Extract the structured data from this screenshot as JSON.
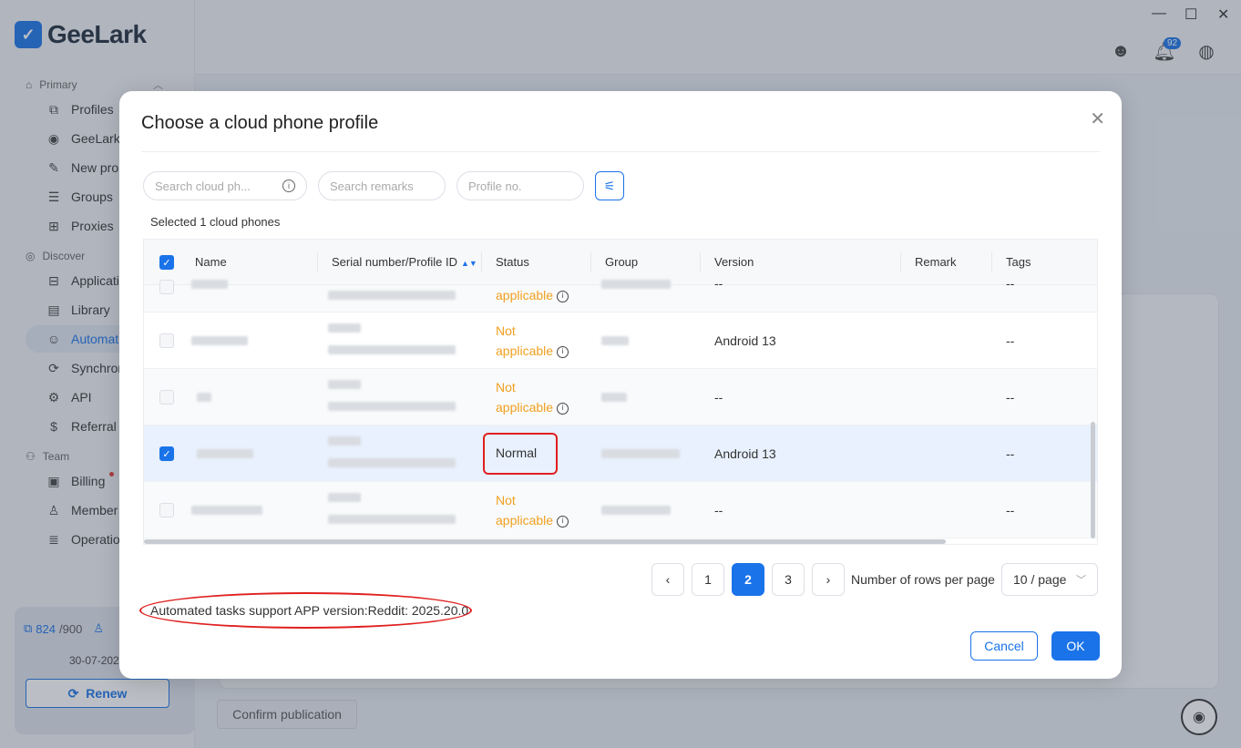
{
  "app": {
    "logo_text": "GeeLark",
    "window_controls": [
      "—",
      "☐",
      "✕"
    ],
    "notification_count": "92"
  },
  "sidebar": {
    "section_primary": "Primary",
    "section_discover": "Discover",
    "section_team": "Team",
    "items": [
      {
        "label": "Profiles",
        "icon": "profiles-icon"
      },
      {
        "label": "GeeLark",
        "icon": "eye-icon"
      },
      {
        "label": "New pro",
        "icon": "edit-icon"
      },
      {
        "label": "Groups",
        "icon": "list-icon"
      },
      {
        "label": "Proxies",
        "icon": "network-icon"
      },
      {
        "label": "Applicati",
        "icon": "apps-icon"
      },
      {
        "label": "Library",
        "icon": "library-icon"
      },
      {
        "label": "Automat",
        "icon": "robot-icon"
      },
      {
        "label": "Synchror",
        "icon": "sync-icon"
      },
      {
        "label": "API",
        "icon": "api-icon"
      },
      {
        "label": "Referral",
        "icon": "dollar-icon"
      },
      {
        "label": "Billing",
        "icon": "billing-icon"
      },
      {
        "label": "Member",
        "icon": "person-icon"
      },
      {
        "label": "Operatio",
        "icon": "log-icon"
      }
    ],
    "quota_used": "824",
    "quota_total": "/900",
    "expire_date": "30-07-202",
    "renew_label": "Renew"
  },
  "background": {
    "confirm_publication": "Confirm publication"
  },
  "modal": {
    "title": "Choose a cloud phone profile",
    "search_cloud_placeholder": "Search cloud ph...",
    "search_remarks_placeholder": "Search remarks",
    "profile_no_placeholder": "Profile no.",
    "selected_text": "Selected 1 cloud phones",
    "columns": [
      "Name",
      "Serial number/Profile ID",
      "Status",
      "Group",
      "Version",
      "Remark",
      "Tags"
    ],
    "rows": [
      {
        "status_line1": "",
        "status_line2": "applicable",
        "version": "--",
        "tags": "--",
        "selected": false
      },
      {
        "status_line1": "Not",
        "status_line2": "applicable",
        "version": "Android 13",
        "tags": "--",
        "selected": false
      },
      {
        "status_line1": "Not",
        "status_line2": "applicable",
        "version": "--",
        "tags": "--",
        "selected": false
      },
      {
        "status": "Normal",
        "version": "Android 13",
        "tags": "--",
        "selected": true
      },
      {
        "status_line1": "Not",
        "status_line2": "applicable",
        "version": "--",
        "tags": "--",
        "selected": false
      }
    ],
    "pagination": {
      "prev": "‹",
      "pages": [
        "1",
        "2",
        "3"
      ],
      "current": "2",
      "next": "›",
      "rows_label": "Number of rows per page",
      "page_size": "10 / page"
    },
    "support_note": "Automated tasks support APP version:Reddit: 2025.20.0",
    "cancel_label": "Cancel",
    "ok_label": "OK"
  }
}
